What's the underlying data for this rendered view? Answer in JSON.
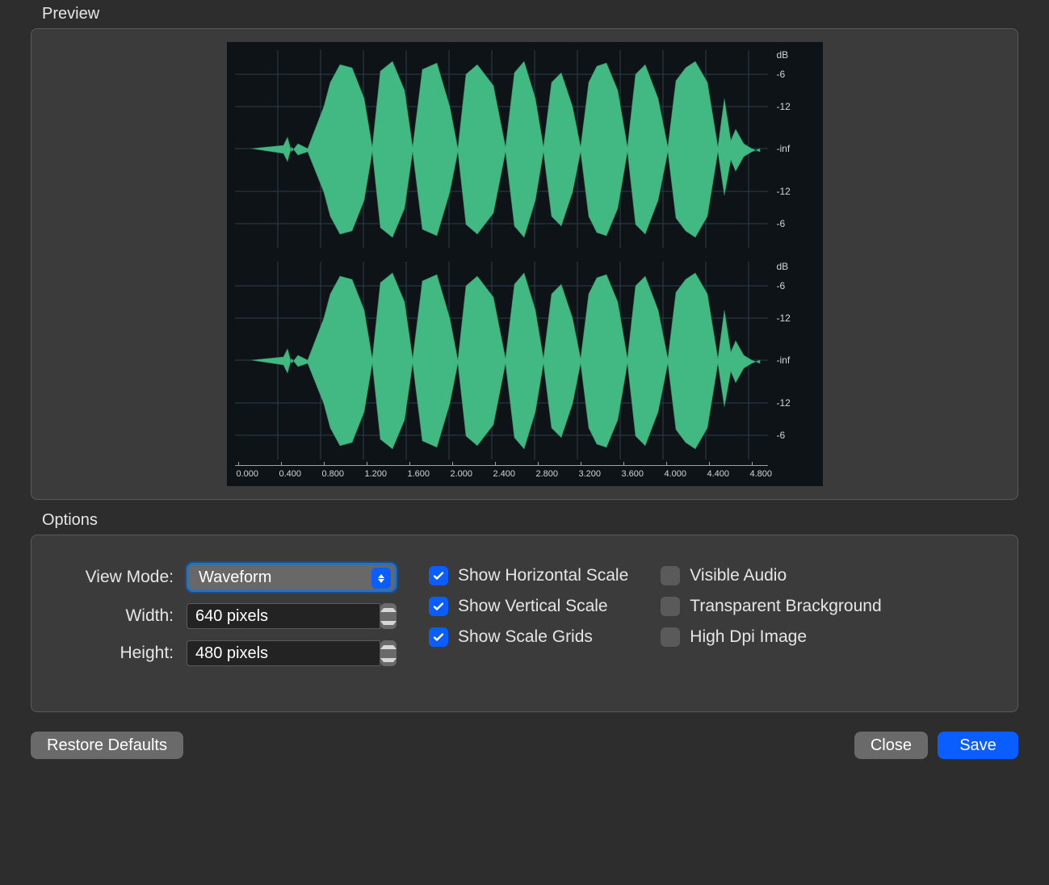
{
  "colors": {
    "accent": "#0a5dff",
    "waveform": "#42b883",
    "panel": "#3b3b3b"
  },
  "preview": {
    "label": "Preview",
    "db_unit": "dB",
    "db_ticks": [
      "-6",
      "-12",
      "-inf",
      "-12",
      "-6"
    ],
    "time_ticks": [
      "0.000",
      "0.400",
      "0.800",
      "1.200",
      "1.600",
      "2.000",
      "2.400",
      "2.800",
      "3.200",
      "3.600",
      "4.000",
      "4.400",
      "4.800"
    ]
  },
  "options": {
    "label": "Options",
    "view_mode": {
      "label": "View Mode:",
      "value": "Waveform"
    },
    "width": {
      "label": "Width:",
      "value": "640 pixels"
    },
    "height": {
      "label": "Height:",
      "value": "480 pixels"
    },
    "checks_left": [
      {
        "key": "hscale",
        "label": "Show Horizontal Scale",
        "checked": true
      },
      {
        "key": "vscale",
        "label": "Show Vertical Scale",
        "checked": true
      },
      {
        "key": "grids",
        "label": "Show Scale Grids",
        "checked": true
      }
    ],
    "checks_right": [
      {
        "key": "visaudio",
        "label": "Visible Audio",
        "checked": false
      },
      {
        "key": "transbg",
        "label": "Transparent Brackground",
        "checked": false
      },
      {
        "key": "hidpi",
        "label": "High Dpi Image",
        "checked": false
      }
    ]
  },
  "footer": {
    "restore": "Restore Defaults",
    "close": "Close",
    "save": "Save"
  }
}
